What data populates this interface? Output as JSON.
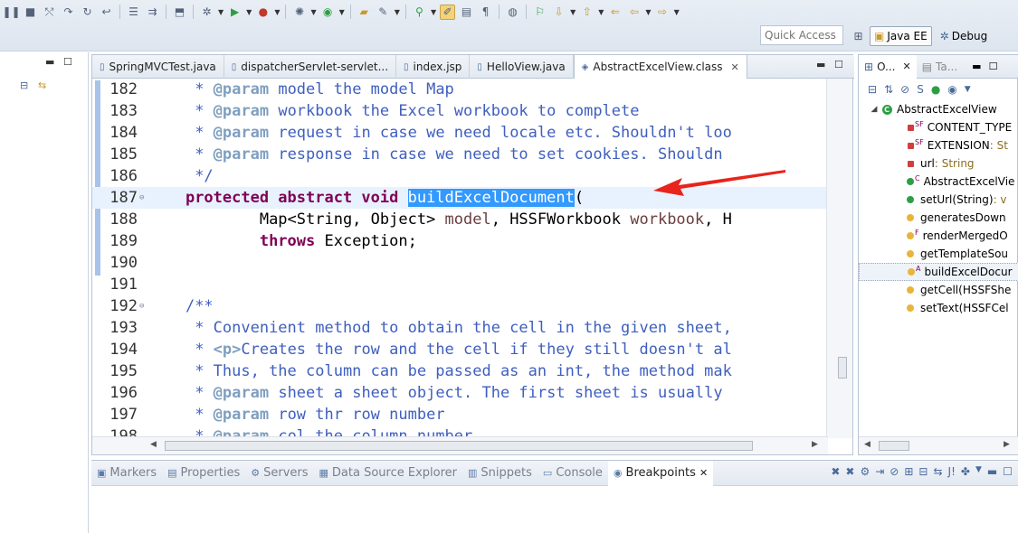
{
  "toolbar": {
    "quick_access_placeholder": "Quick Access",
    "perspectives": [
      {
        "label": "Java EE",
        "active": true
      },
      {
        "label": "Debug",
        "active": false
      }
    ]
  },
  "editor": {
    "tabs": [
      {
        "label": "SpringMVCTest.java",
        "active": false
      },
      {
        "label": "dispatcherServlet-servlet...",
        "active": false
      },
      {
        "label": "index.jsp",
        "active": false
      },
      {
        "label": "HelloView.java",
        "active": false
      },
      {
        "label": "AbstractExcelView.class",
        "active": true
      }
    ],
    "lines": [
      {
        "num": "182",
        "indent": "     ",
        "tokens": [
          [
            "doc",
            "* "
          ],
          [
            "tag",
            "@param"
          ],
          [
            "doc",
            " model the model Map"
          ]
        ]
      },
      {
        "num": "183",
        "indent": "     ",
        "tokens": [
          [
            "doc",
            "* "
          ],
          [
            "tag",
            "@param"
          ],
          [
            "doc",
            " workbook the Excel workbook to complete"
          ]
        ]
      },
      {
        "num": "184",
        "indent": "     ",
        "tokens": [
          [
            "doc",
            "* "
          ],
          [
            "tag",
            "@param"
          ],
          [
            "doc",
            " request in case we need locale etc. Shouldn't loo"
          ]
        ]
      },
      {
        "num": "185",
        "indent": "     ",
        "tokens": [
          [
            "doc",
            "* "
          ],
          [
            "tag",
            "@param"
          ],
          [
            "doc",
            " response in case we need to set cookies. Shouldn"
          ]
        ]
      },
      {
        "num": "186",
        "indent": "     ",
        "tokens": [
          [
            "doc",
            "*/"
          ]
        ]
      },
      {
        "num": "187",
        "indent": "    ",
        "fold": true,
        "current": true,
        "tokens": [
          [
            "kw",
            "protected abstract void "
          ],
          [
            "sel",
            "buildExcelDocument"
          ],
          [
            "plain",
            "("
          ]
        ]
      },
      {
        "num": "188",
        "indent": "            ",
        "tokens": [
          [
            "plain",
            "Map<String, Object> "
          ],
          [
            "param",
            "model"
          ],
          [
            "plain",
            ", HSSFWorkbook "
          ],
          [
            "param",
            "workbook"
          ],
          [
            "plain",
            ", H"
          ]
        ]
      },
      {
        "num": "189",
        "indent": "            ",
        "tokens": [
          [
            "kw",
            "throws "
          ],
          [
            "plain",
            "Exception;"
          ]
        ]
      },
      {
        "num": "190",
        "indent": "",
        "tokens": []
      },
      {
        "num": "191",
        "indent": "",
        "tokens": []
      },
      {
        "num": "192",
        "indent": "    ",
        "fold": true,
        "tokens": [
          [
            "doc",
            "/**"
          ]
        ]
      },
      {
        "num": "193",
        "indent": "     ",
        "tokens": [
          [
            "doc",
            "* Convenient method to obtain the cell in the given sheet,"
          ]
        ]
      },
      {
        "num": "194",
        "indent": "     ",
        "tokens": [
          [
            "doc",
            "* "
          ],
          [
            "tagl",
            "<p>"
          ],
          [
            "doc",
            "Creates the row and the cell if they still doesn't al"
          ]
        ]
      },
      {
        "num": "195",
        "indent": "     ",
        "tokens": [
          [
            "doc",
            "* Thus, the column can be passed as an int, the method mak"
          ]
        ]
      },
      {
        "num": "196",
        "indent": "     ",
        "tokens": [
          [
            "doc",
            "* "
          ],
          [
            "tag",
            "@param"
          ],
          [
            "doc",
            " sheet a sheet object. The first sheet is usually"
          ]
        ]
      },
      {
        "num": "197",
        "indent": "     ",
        "tokens": [
          [
            "doc",
            "* "
          ],
          [
            "tag",
            "@param"
          ],
          [
            "doc",
            " row thr row number"
          ]
        ]
      },
      {
        "num": "198",
        "indent": "     ",
        "tokens": [
          [
            "doc",
            "* "
          ],
          [
            "tag",
            "@param"
          ],
          [
            "doc",
            " col the column number"
          ]
        ]
      }
    ]
  },
  "outline": {
    "tabs": [
      {
        "label": "O...",
        "active": true
      },
      {
        "label": "Ta...",
        "active": false
      }
    ],
    "items": [
      {
        "label": "AbstractExcelView",
        "type": "",
        "icon": "class",
        "depth": 0,
        "twisty": "◢"
      },
      {
        "label": "CONTENT_TYPE",
        "type": "",
        "icon": "red",
        "sup": "SF",
        "depth": 1
      },
      {
        "label": "EXTENSION",
        "type": " : St",
        "icon": "red",
        "sup": "SF",
        "depth": 1
      },
      {
        "label": "url",
        "type": " : String",
        "icon": "red",
        "sup": "",
        "depth": 1
      },
      {
        "label": "AbstractExcelVie",
        "type": "",
        "icon": "green",
        "sup": "C",
        "depth": 1
      },
      {
        "label": "setUrl(String)",
        "type": " : v",
        "icon": "green",
        "sup": "",
        "depth": 1
      },
      {
        "label": "generatesDown",
        "type": "",
        "icon": "yellow",
        "sup": "",
        "depth": 1
      },
      {
        "label": "renderMergedO",
        "type": "",
        "icon": "yellow",
        "sup": "F",
        "depth": 1
      },
      {
        "label": "getTemplateSou",
        "type": "",
        "icon": "yellow",
        "sup": "",
        "depth": 1
      },
      {
        "label": "buildExcelDocur",
        "type": "",
        "icon": "yellow",
        "sup": "A",
        "depth": 1,
        "selected": true
      },
      {
        "label": "getCell(HSSFShe",
        "type": "",
        "icon": "yellow",
        "sup": "",
        "depth": 1
      },
      {
        "label": "setText(HSSFCel",
        "type": "",
        "icon": "yellow",
        "sup": "",
        "depth": 1
      }
    ]
  },
  "bottom": {
    "tabs": [
      {
        "label": "Markers",
        "icon": "markers-icon",
        "active": false
      },
      {
        "label": "Properties",
        "icon": "properties-icon",
        "active": false
      },
      {
        "label": "Servers",
        "icon": "servers-icon",
        "active": false
      },
      {
        "label": "Data Source Explorer",
        "icon": "data-source-icon",
        "active": false
      },
      {
        "label": "Snippets",
        "icon": "snippets-icon",
        "active": false
      },
      {
        "label": "Console",
        "icon": "console-icon",
        "active": false
      },
      {
        "label": "Breakpoints",
        "icon": "breakpoints-icon",
        "active": true
      }
    ]
  }
}
